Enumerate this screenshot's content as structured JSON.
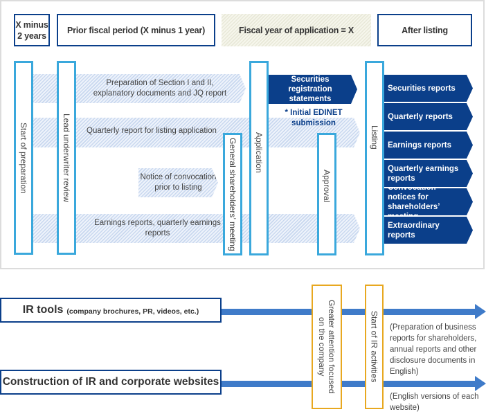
{
  "colors": {
    "navy": "#0b3f8a",
    "light_blue": "#3aa8dc",
    "arrow_blue": "#3f7bc9",
    "orange": "#e8a820",
    "frame_gray": "#dcdcdc"
  },
  "header": {
    "periods": [
      {
        "label_line1": "X minus",
        "label_line2": "2 years"
      },
      {
        "label": "Prior fiscal period (X minus 1 year)"
      },
      {
        "label": "Fiscal year of application = X"
      },
      {
        "label": "After listing"
      }
    ]
  },
  "milestones": {
    "start_of_preparation": "Start of preparation",
    "lead_underwriter_review": "Lead underwriter review",
    "general_shareholders_meeting": "General shareholders’ meeting",
    "application": "Application",
    "approval": "Approval",
    "listing": "Listing"
  },
  "tasks": {
    "section_prep": {
      "line1": "Preparation of Section I and II,",
      "line2": "explanatory documents and JQ report"
    },
    "quarterly_listing": "Quarterly report for listing application",
    "notice_convocation": {
      "line1": "Notice of convocation",
      "line2": "prior to listing"
    },
    "earnings": {
      "line1": "Earnings reports, quarterly earnings",
      "line2": "reports"
    }
  },
  "securities_registration": {
    "line1": "Securities registration",
    "line2": "statements"
  },
  "edinet_note": {
    "line1": "* Initial EDINET",
    "line2": "submission"
  },
  "after_listing_reports": [
    {
      "line1": "Securities reports"
    },
    {
      "line1": "Quarterly reports"
    },
    {
      "line1": "Earnings reports"
    },
    {
      "line1": "Quarterly earnings",
      "line2": "reports"
    },
    {
      "line1": "Convocation notices for",
      "line2": "shareholders’ meeting"
    },
    {
      "line1": "Extraordinary reports"
    }
  ],
  "ir": {
    "tools": {
      "title": "IR tools",
      "subtitle": "(company brochures, PR, videos, etc.)"
    },
    "websites": {
      "title": "Construction of IR and corporate websites"
    },
    "greater_attention": {
      "line1": "Greater attention focused",
      "line2": "on the company"
    },
    "start_ir": "Start of IR activities",
    "tools_note": [
      "(Preparation of business",
      "reports for shareholders,",
      "annual reports and other",
      "disclosure documents in",
      "English)"
    ],
    "websites_note": [
      "(English versions of each",
      "website)"
    ]
  }
}
